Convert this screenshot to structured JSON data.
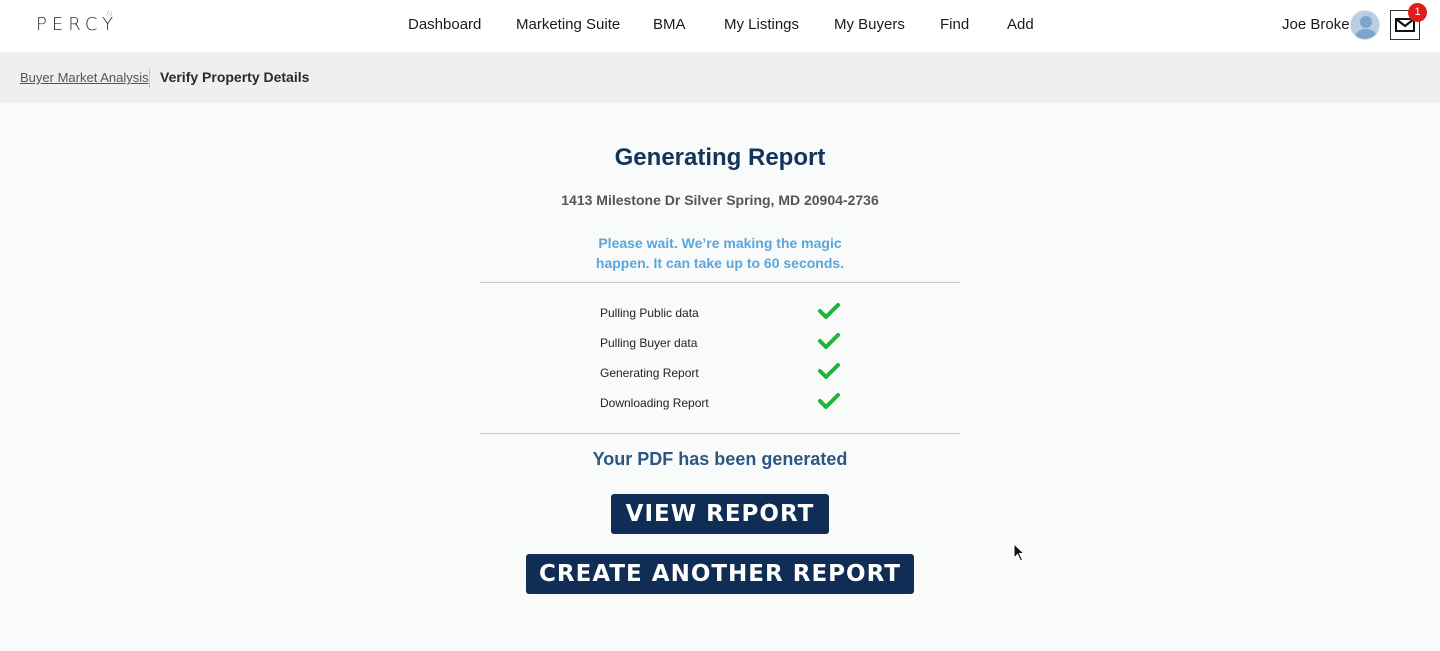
{
  "brand": {
    "logo_text": "PERCY",
    "logo_sup": "AI"
  },
  "nav": {
    "items": [
      {
        "label": "Dashboard"
      },
      {
        "label": "Marketing Suite"
      },
      {
        "label": "BMA"
      },
      {
        "label": "My Listings"
      },
      {
        "label": "My Buyers"
      },
      {
        "label": "Find"
      },
      {
        "label": "Add"
      }
    ],
    "user_name": "Joe Broker",
    "notification_count": "1"
  },
  "breadcrumb": {
    "parent": "Buyer Market Analysis",
    "current": "Verify Property Details"
  },
  "main": {
    "title": "Generating Report",
    "address": "1413 Milestone Dr Silver Spring, MD 20904-2736",
    "wait_line1": "Please wait. We’re making the magic",
    "wait_line2": "happen. It can take up to 60 seconds.",
    "steps": [
      {
        "label": "Pulling Public data",
        "status": "complete"
      },
      {
        "label": "Pulling Buyer data",
        "status": "complete"
      },
      {
        "label": "Generating Report",
        "status": "complete"
      },
      {
        "label": "Downloading Report",
        "status": "complete"
      }
    ],
    "done_message": "Your PDF has been generated",
    "view_button": "VIEW REPORT",
    "create_button": "CREATE ANOTHER REPORT"
  },
  "colors": {
    "primary_navy": "#0f2d55",
    "title": "#14355a",
    "wait_text": "#5aa6db",
    "check_green": "#1fb43a",
    "badge_red": "#e21b1b"
  }
}
